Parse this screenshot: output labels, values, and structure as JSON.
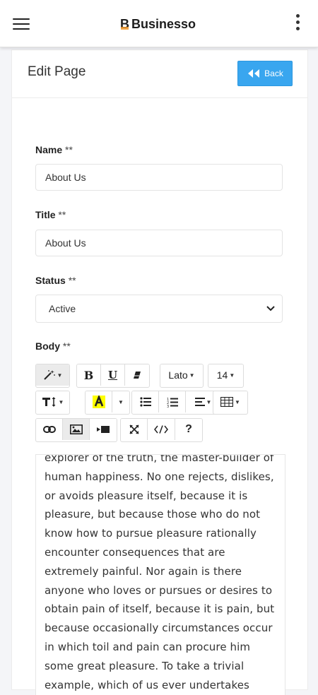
{
  "header": {
    "brand_mark": "B",
    "brand_name": "Businesso",
    "menu_icon": "hamburger-icon",
    "more_icon": "kebab-icon"
  },
  "page": {
    "title": "Edit Page",
    "back_label": "Back",
    "back_icon": "double-chevron-left-icon"
  },
  "form": {
    "name": {
      "label": "Name",
      "required": "**",
      "value": "About Us"
    },
    "title": {
      "label": "Title",
      "required": "**",
      "value": "About Us"
    },
    "status": {
      "label": "Status",
      "required": "**",
      "value": "Active"
    },
    "body": {
      "label": "Body",
      "required": "**"
    }
  },
  "toolbar": {
    "font_family": "Lato",
    "font_size": "14",
    "bold": "B",
    "underline": "U",
    "help": "?"
  },
  "editor": {
    "content": "explorer of the truth, the master-builder of human happiness. No one rejects, dislikes, or avoids pleasure itself, because it is pleasure, but because those who do not know how to pursue pleasure rationally encounter consequences that are extremely painful. Nor again is there anyone who loves or pursues or desires to obtain pain of itself, because it is pain, but because occasionally circumstances occur in which toil and pain can procure him some great pleasure. To take a trivial example, which of us ever undertakes"
  },
  "colors": {
    "accent": "#39a6ef",
    "brand_underline": "#f39b2f",
    "highlight": "#ffff00"
  }
}
